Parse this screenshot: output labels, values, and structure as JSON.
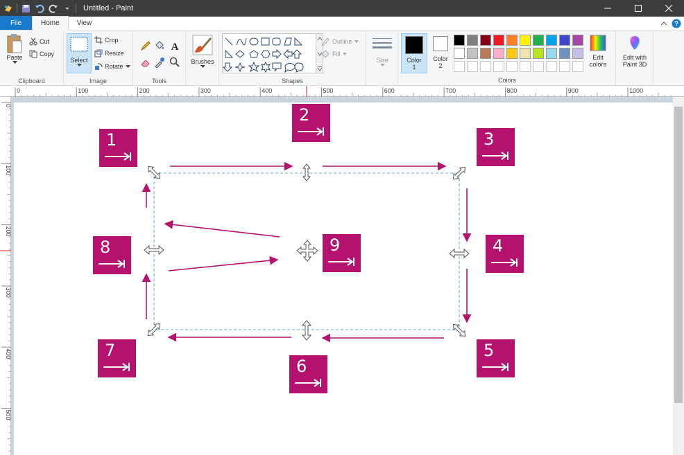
{
  "window": {
    "title": "Untitled - Paint",
    "minimize_icon": "minimize-icon",
    "maximize_icon": "maximize-icon",
    "close_icon": "close-icon"
  },
  "quick_access": {
    "icons": [
      "paint-app-icon",
      "save-icon",
      "undo-icon",
      "redo-icon",
      "customize-dropdown-icon"
    ]
  },
  "tabs": {
    "file": "File",
    "home": "Home",
    "view": "View"
  },
  "ribbon": {
    "clipboard": {
      "label": "Clipboard",
      "paste": "Paste",
      "cut": "Cut",
      "copy": "Copy"
    },
    "image": {
      "label": "Image",
      "select": "Select",
      "crop": "Crop",
      "resize": "Resize",
      "rotate": "Rotate"
    },
    "tools": {
      "label": "Tools"
    },
    "brushes": {
      "label": "Brushes"
    },
    "shapes": {
      "label": "Shapes",
      "outline": "Outline",
      "fill": "Fill"
    },
    "size": {
      "label": "Size"
    },
    "colors": {
      "label": "Colors",
      "color1": "Color",
      "color1_num": "1",
      "color2": "Color",
      "color2_num": "2",
      "edit_colors_1": "Edit",
      "edit_colors_2": "colors",
      "edit_3d_1": "Edit with",
      "edit_3d_2": "Paint 3D",
      "palette": [
        "#000000",
        "#7f7f7f",
        "#880015",
        "#ed1c24",
        "#ff7f27",
        "#fff200",
        "#22b14c",
        "#00a2e8",
        "#3f48cc",
        "#a349a4",
        "#ffffff",
        "#c3c3c3",
        "#b97a57",
        "#ffaec9",
        "#ffc90e",
        "#efe4b0",
        "#b5e61d",
        "#99d9ea",
        "#7092be",
        "#c8bfe7",
        "#ffffff",
        "#ffffff",
        "#ffffff",
        "#ffffff",
        "#ffffff",
        "#ffffff",
        "#ffffff",
        "#ffffff",
        "#ffffff",
        "#ffffff"
      ]
    }
  },
  "ruler": {
    "h_labels": [
      "0",
      "100",
      "200",
      "300",
      "400",
      "500",
      "600",
      "700",
      "800",
      "900",
      "1000"
    ],
    "v_labels": [
      "0",
      "100",
      "200",
      "300",
      "400",
      "500"
    ]
  },
  "badges": [
    "1",
    "2",
    "3",
    "4",
    "5",
    "6",
    "7",
    "8",
    "9"
  ],
  "accent": "#b5116f"
}
